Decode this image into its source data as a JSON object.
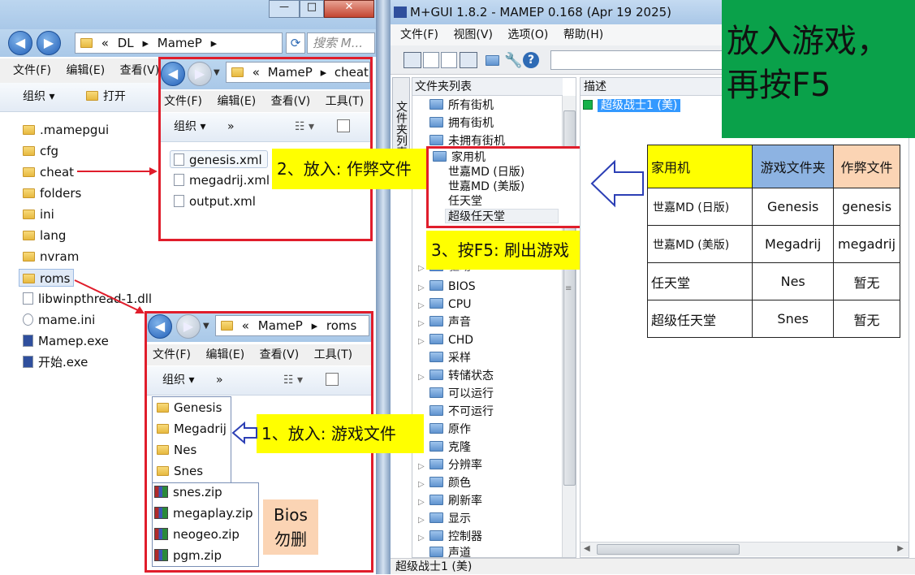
{
  "explorer_main": {
    "window_controls": {
      "minimize": "—",
      "maximize": "□",
      "close": "✕"
    },
    "address": {
      "prefix": "«",
      "path1": "DL",
      "sep": "▸",
      "path2": "MameP",
      "sep2": "▸"
    },
    "search_placeholder": "搜索 M...",
    "menu": [
      "文件(F)",
      "编辑(E)",
      "查看(V)"
    ],
    "cmd": {
      "organize": "组织 ▾",
      "open": "打开"
    },
    "items": [
      ".mamepgui",
      "cfg",
      "cheat",
      "folders",
      "ini",
      "lang",
      "nvram",
      "roms",
      "libwinpthread-1.dll",
      "mame.ini",
      "Mamep.exe",
      "开始.exe"
    ]
  },
  "explorer_cheat": {
    "address": {
      "prefix": "«",
      "path1": "MameP",
      "sep": "▸",
      "path2": "cheat"
    },
    "menu": [
      "文件(F)",
      "编辑(E)",
      "查看(V)",
      "工具(T)"
    ],
    "cmd": {
      "organize": "组织 ▾",
      "more": "»"
    },
    "files": [
      "genesis.xml",
      "megadrij.xml",
      "output.xml"
    ]
  },
  "explorer_roms": {
    "address": {
      "prefix": "«",
      "path1": "MameP",
      "sep": "▸",
      "path2": "roms"
    },
    "menu": [
      "文件(F)",
      "编辑(E)",
      "查看(V)",
      "工具(T)"
    ],
    "cmd": {
      "organize": "组织 ▾",
      "more": "»"
    },
    "folders": [
      "Genesis",
      "Megadrij",
      "Nes",
      "Snes"
    ],
    "zips": [
      "snes.zip",
      "megaplay.zip",
      "neogeo.zip",
      "pgm.zip"
    ]
  },
  "mamegui": {
    "title": "M+GUI 1.8.2 - MAMEP 0.168 (Apr 19 2025)",
    "menu": [
      "文件(F)",
      "视图(V)",
      "选项(O)",
      "帮助(H)"
    ],
    "side_tab": "文件夹列表",
    "folder_header": "文件夹列表",
    "tree_top": [
      "所有街机",
      "拥有街机",
      "未拥有街机"
    ],
    "console_folder": "家用机",
    "console_children": [
      "世嘉MD (日版)",
      "世嘉MD (美版)",
      "任天堂",
      "超级任天堂"
    ],
    "hidden_item": "驱动",
    "tree_rest": [
      "BIOS",
      "CPU",
      "声音",
      "CHD",
      "采样",
      "转储状态",
      "可以运行",
      "不可运行",
      "原作",
      "克隆",
      "分辨率",
      "颜色",
      "刷新率",
      "显示",
      "控制器",
      "声道"
    ],
    "list_header": "描述",
    "list_item": "超级战士1 (美)",
    "status": "超级战士1 (美)"
  },
  "annotations": {
    "step1": "1、放入: 游戏文件",
    "step2": "2、放入: 作弊文件",
    "step3": "3、按F5: 刷出游戏",
    "bios_note_line1": "Bios",
    "bios_note_line2": "勿删",
    "green_line1": "放入游戏，",
    "green_line2": "再按F5"
  },
  "table": {
    "headers": [
      "家用机",
      "游戏文件夹",
      "作弊文件"
    ],
    "rows": [
      [
        "世嘉MD (日版)",
        "Genesis",
        "genesis"
      ],
      [
        "世嘉MD (美版)",
        "Megadrij",
        "megadrij"
      ],
      [
        "任天堂",
        "Nes",
        "暂无"
      ],
      [
        "超级任天堂",
        "Snes",
        "暂无"
      ]
    ]
  },
  "colors": {
    "red": "#e01d2b",
    "yellow": "#ffff00",
    "green": "#0aa14a",
    "blue_header": "#8db3e2",
    "peach_header": "#fbd4b4",
    "arrow_blue": "#2c3fb5"
  }
}
